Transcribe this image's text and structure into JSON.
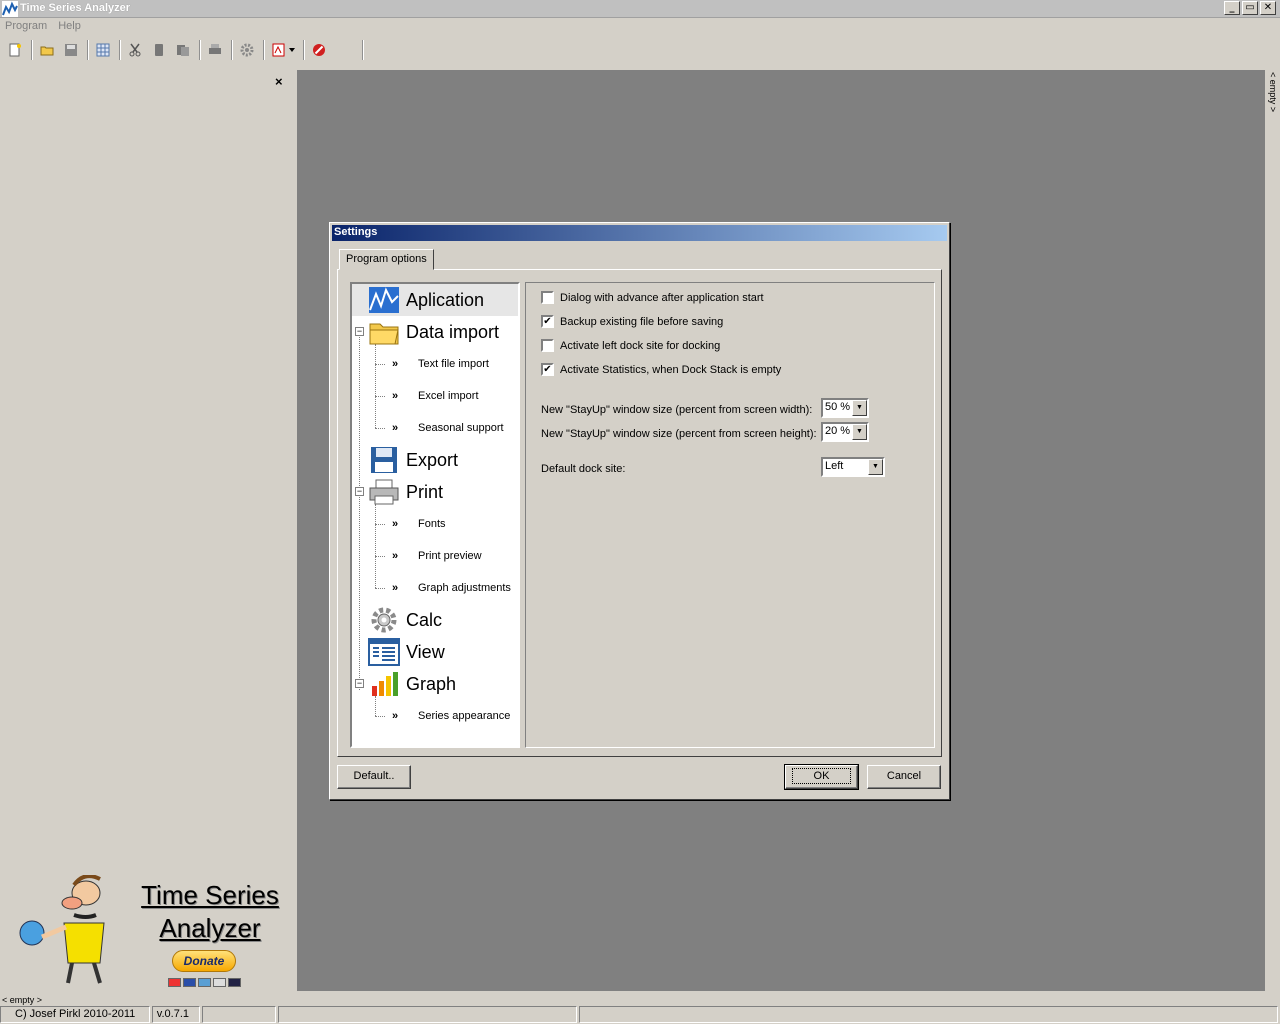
{
  "window": {
    "title": "Time Series Analyzer",
    "minimize": "_",
    "maximize": "▭",
    "close": "✕"
  },
  "menu": [
    "Program",
    "Help"
  ],
  "left_dock": {
    "close_glyph": "×",
    "logo_line1": "Time Series",
    "logo_line2": "Analyzer",
    "donate_label": "Donate",
    "empty_label": "< empty >"
  },
  "right_dock": {
    "empty_label": "< empty >"
  },
  "statusbar": {
    "copyright": "C) Josef Pirkl 2010-2011",
    "version": "v.0.7.1"
  },
  "dialog": {
    "title": "Settings",
    "tab_label": "Program options",
    "tree": {
      "aplication": "Aplication",
      "data_import": "Data import",
      "text_file_import": "Text file import",
      "excel_import": "Excel import",
      "seasonal_support": "Seasonal support",
      "export": "Export",
      "print": "Print",
      "fonts": "Fonts",
      "print_preview": "Print preview",
      "graph_adjustments": "Graph adjustments",
      "calc": "Calc",
      "view": "View",
      "graph": "Graph",
      "series_appearance": "Series appearance",
      "sub_arrow": "»",
      "expander_glyph": "−"
    },
    "options": {
      "chk1": {
        "label": "Dialog with advance after application start",
        "checked": false
      },
      "chk2": {
        "label": "Backup existing file before saving",
        "checked": true
      },
      "chk3": {
        "label": "Activate left dock site for docking",
        "checked": false
      },
      "chk4": {
        "label": "Activate Statistics, when Dock Stack is empty",
        "checked": true
      },
      "width_label": "New \"StayUp\" window size (percent from screen width):",
      "width_value": "50 %",
      "height_label": "New \"StayUp\" window size (percent from screen height):",
      "height_value": "20 %",
      "dock_label": "Default dock site:",
      "dock_value": "Left",
      "check_glyph": "✔",
      "dropdown_glyph": "▼"
    },
    "buttons": {
      "default": "Default..",
      "ok": "OK",
      "cancel": "Cancel"
    }
  }
}
